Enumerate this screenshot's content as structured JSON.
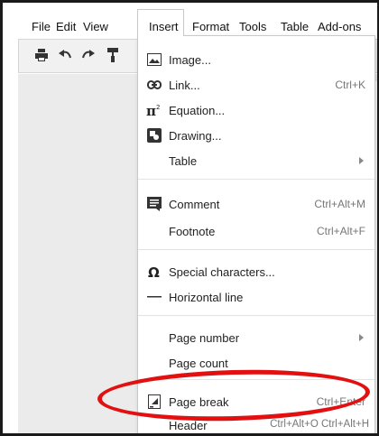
{
  "menubar": {
    "items": [
      "File",
      "Edit",
      "View",
      "Insert",
      "Format",
      "Tools",
      "Table",
      "Add-ons"
    ]
  },
  "toolbar": {
    "icons": [
      "print-icon",
      "undo-icon",
      "redo-icon",
      "paint-format-icon"
    ],
    "overflow_label": "..."
  },
  "insert_menu": {
    "items": [
      {
        "label": "Image...",
        "shortcut": "",
        "icon": "image-icon",
        "submenu": false
      },
      {
        "label": "Link...",
        "shortcut": "Ctrl+K",
        "icon": "link-icon",
        "submenu": false
      },
      {
        "label": "Equation...",
        "shortcut": "",
        "icon": "equation-icon",
        "submenu": false
      },
      {
        "label": "Drawing...",
        "shortcut": "",
        "icon": "drawing-icon",
        "submenu": false
      },
      {
        "label": "Table",
        "shortcut": "",
        "icon": "",
        "submenu": true
      },
      {
        "label": "Comment",
        "shortcut": "Ctrl+Alt+M",
        "icon": "comment-icon",
        "submenu": false
      },
      {
        "label": "Footnote",
        "shortcut": "Ctrl+Alt+F",
        "icon": "",
        "submenu": false
      },
      {
        "label": "Special characters...",
        "shortcut": "",
        "icon": "omega-icon",
        "submenu": false
      },
      {
        "label": "Horizontal line",
        "shortcut": "",
        "icon": "horizontal-line-icon",
        "submenu": false
      },
      {
        "label": "Page number",
        "shortcut": "",
        "icon": "",
        "submenu": true
      },
      {
        "label": "Page count",
        "shortcut": "",
        "icon": "",
        "submenu": false
      },
      {
        "label": "Page break",
        "shortcut": "Ctrl+Enter",
        "icon": "page-break-icon",
        "submenu": false
      },
      {
        "label": "Header",
        "shortcut": "Ctrl+Alt+O Ctrl+Alt+H",
        "icon": "",
        "submenu": false
      }
    ]
  },
  "annotation": {
    "color": "#e21010",
    "target": "Page break"
  }
}
